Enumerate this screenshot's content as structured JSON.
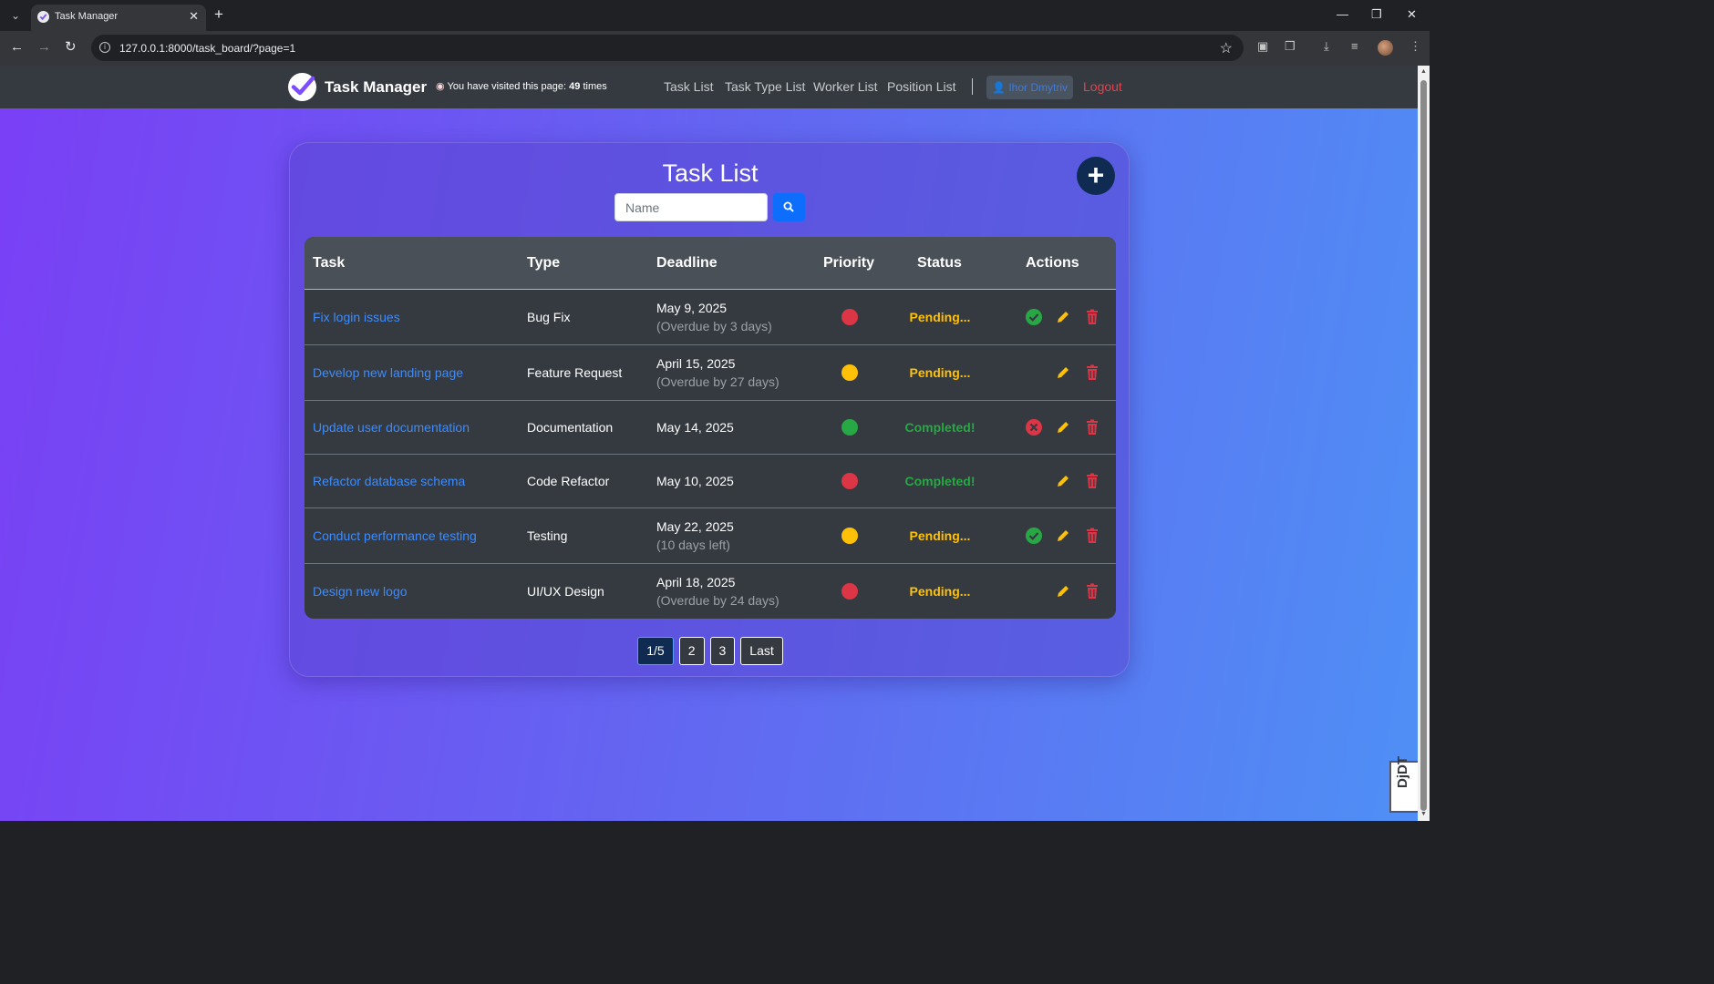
{
  "browser": {
    "tab_title": "Task Manager",
    "url": "127.0.0.1:8000/task_board/?page=1"
  },
  "navbar": {
    "brand": "Task Manager",
    "visit_prefix": "You have visited this page:",
    "visit_count": "49",
    "visit_suffix": "times",
    "links": [
      "Task List",
      "Task Type List",
      "Worker List",
      "Position List"
    ],
    "user": "Ihor Dmytriv",
    "logout": "Logout"
  },
  "page": {
    "title": "Task List",
    "search_placeholder": "Name"
  },
  "table": {
    "headers": {
      "task": "Task",
      "type": "Type",
      "deadline": "Deadline",
      "priority": "Priority",
      "status": "Status",
      "actions": "Actions"
    },
    "rows": [
      {
        "task": "Fix login issues",
        "type": "Bug Fix",
        "deadline": "May 9, 2025",
        "note": "(Overdue by 3 days)",
        "priority": "high",
        "status": "Pending...",
        "action": "complete"
      },
      {
        "task": "Develop new landing page",
        "type": "Feature Request",
        "deadline": "April 15, 2025",
        "note": "(Overdue by 27 days)",
        "priority": "medium",
        "status": "Pending...",
        "action": "none"
      },
      {
        "task": "Update user documentation",
        "type": "Documentation",
        "deadline": "May 14, 2025",
        "note": "",
        "priority": "low",
        "status": "Completed!",
        "action": "undo"
      },
      {
        "task": "Refactor database schema",
        "type": "Code Refactor",
        "deadline": "May 10, 2025",
        "note": "",
        "priority": "high",
        "status": "Completed!",
        "action": "none"
      },
      {
        "task": "Conduct performance testing",
        "type": "Testing",
        "deadline": "May 22, 2025",
        "note": "(10 days left)",
        "priority": "medium",
        "status": "Pending...",
        "action": "complete"
      },
      {
        "task": "Design new logo",
        "type": "UI/UX Design",
        "deadline": "April 18, 2025",
        "note": "(Overdue by 24 days)",
        "priority": "high",
        "status": "Pending...",
        "action": "none"
      }
    ]
  },
  "colors": {
    "priority_high": "#dc3545",
    "priority_medium": "#ffc107",
    "priority_low": "#28a745",
    "status_pending": "#ffc107",
    "status_completed": "#28a745",
    "link": "#3d8bfd"
  },
  "pagination": {
    "current": "1/5",
    "pages": [
      "2",
      "3"
    ],
    "last": "Last"
  },
  "debug_toolbar": "DjDT"
}
